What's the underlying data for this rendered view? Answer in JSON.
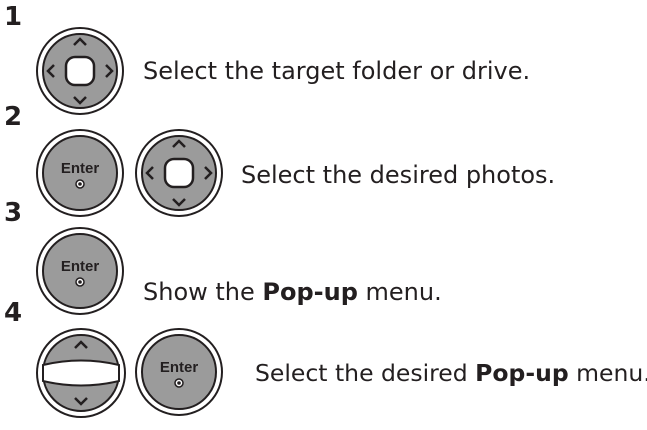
{
  "steps": [
    {
      "number": "1",
      "text": "Select the target folder or drive."
    },
    {
      "number": "2",
      "text": "Select the desired photos."
    },
    {
      "number": "3",
      "text_before": "Show the ",
      "text_bold": "Pop-up",
      "text_after": " menu."
    },
    {
      "number": "4",
      "text_before": "Select the desired ",
      "text_bold": "Pop-up",
      "text_after": " menu."
    }
  ],
  "buttons": {
    "enter_label": "Enter",
    "icons": [
      "navigation-pad-icon",
      "enter-button-icon",
      "up-down-button-icon"
    ]
  },
  "colors": {
    "button_fill": "#9b9b9b",
    "outline": "#231f20",
    "text": "#231f20"
  }
}
